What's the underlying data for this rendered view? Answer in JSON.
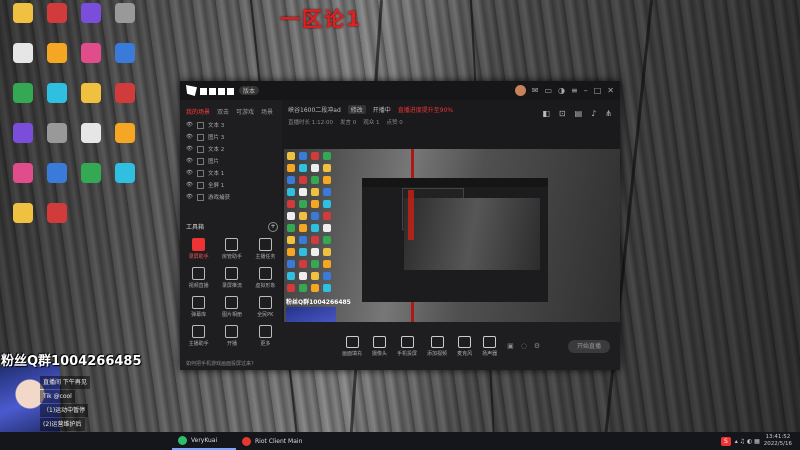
{
  "banner": "一区论1",
  "fan_group": "粉丝Q群1004266485",
  "chat": [
    "直播间 下午再见",
    "Tik @cool",
    "（1)运动中暂停",
    "(2)运营维护后"
  ],
  "desktop_icons": [
    "",
    "",
    "",
    "",
    "",
    "",
    "",
    "",
    "",
    "",
    "",
    "",
    "",
    "",
    "",
    "",
    "",
    "",
    "",
    "",
    "",
    ""
  ],
  "app": {
    "version": "版本",
    "sidebar": {
      "tabs": [
        "我的场景",
        "双击",
        "可游戏",
        "场景"
      ],
      "sources": [
        "文本 3",
        "图片 3",
        "文本 2",
        "图片",
        "文本 1",
        "全屏 1",
        "游戏捕获"
      ],
      "tools_label": "工具箱",
      "tools": [
        "录屏助手",
        "房管助手",
        "主播任务",
        "视频直播",
        "录屏推流",
        "虚拟形象",
        "弹幕库",
        "图片相册",
        "全民PK",
        "主播助手",
        "开播",
        "更多"
      ],
      "footer": "如何把手机游戏画面投屏过来?"
    },
    "header": {
      "title": "峡谷1600二段冲ad",
      "tag": "修改",
      "notice": "开播中",
      "warn": "直播进度提升至90%",
      "stats": [
        "直播时长 1:12:00",
        "发言 0",
        "观众 1",
        "点赞 0"
      ]
    },
    "controls": [
      "画面填充",
      "摄像头",
      "手机投屏",
      "添加视频",
      "麦克风",
      "扬声器"
    ],
    "go_live": "开始直播"
  },
  "taskbar": {
    "apps": [
      "",
      "VeryKuai",
      "Riot Client Main"
    ],
    "time": "13:41:52",
    "date": "2022/5/16"
  },
  "colors": {
    "accent_red": "#e02020",
    "app_bg": "#1c1c1e"
  }
}
